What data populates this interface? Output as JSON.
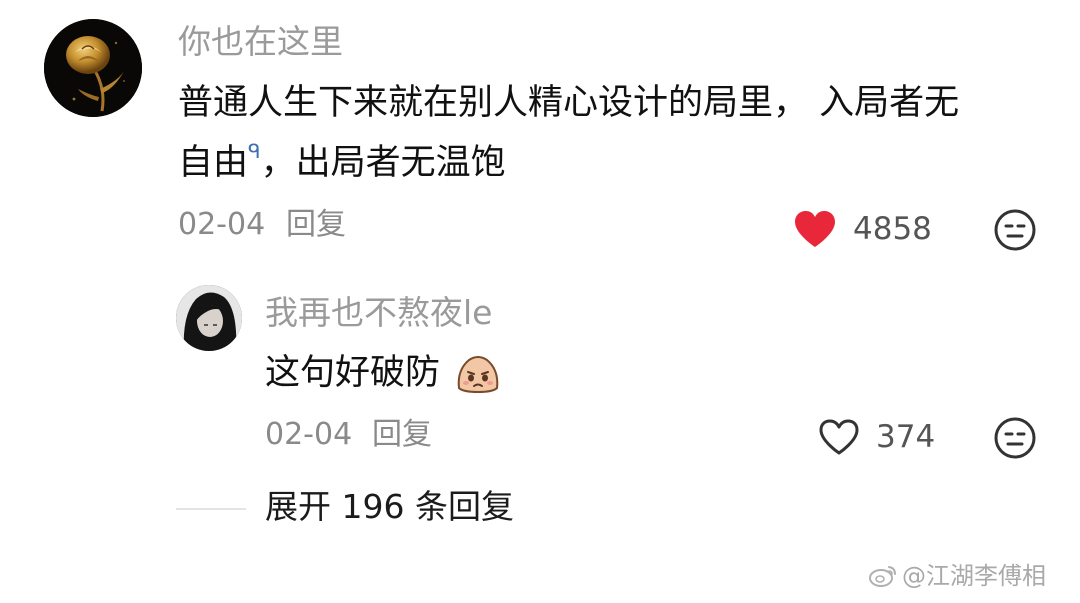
{
  "comment": {
    "username": "你也在这里",
    "text_line1": "普通人生下来就在别人精心设计的局里，  入局者无",
    "text_line2_part1": "自由",
    "search_mark": "ᑫ",
    "text_line2_part2": "，出局者无温饱",
    "date": "02-04",
    "reply_label": "回复",
    "likes": "4858",
    "liked": true,
    "like_color": "#e8283a"
  },
  "reply": {
    "username": "我再也不熬夜le",
    "text": "这句好破防",
    "emoji": "crying-face-emoji",
    "date": "02-04",
    "reply_label": "回复",
    "likes": "374",
    "liked": false
  },
  "expand_replies": "展开 196 条回复",
  "watermark": "@江湖李傅相",
  "icons": {
    "dislike": "neutral-face-icon",
    "like": "heart-icon",
    "weibo": "weibo-logo"
  }
}
